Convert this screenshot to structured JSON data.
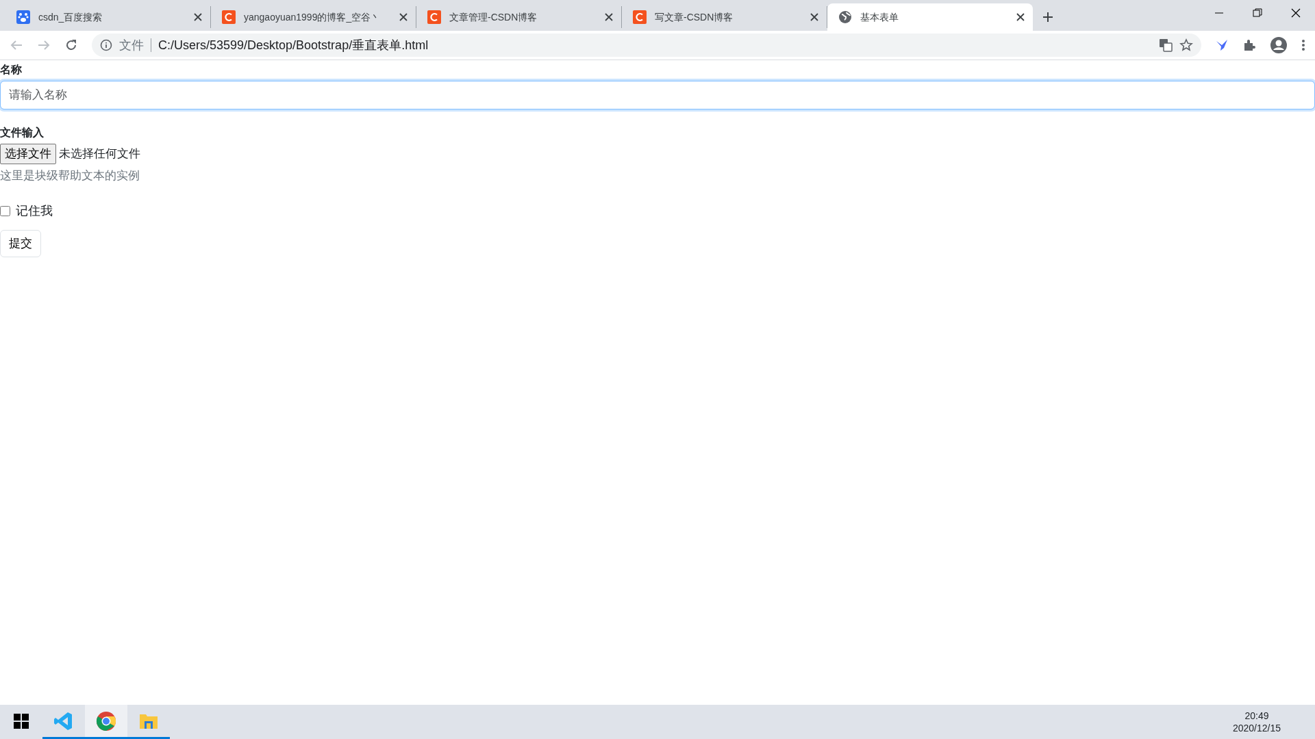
{
  "tabs": [
    {
      "title": "csdn_百度搜索",
      "kind": "paw",
      "selected": false
    },
    {
      "title": "yangaoyuan1999的博客_空谷丶",
      "kind": "csdn",
      "selected": false
    },
    {
      "title": "文章管理-CSDN博客",
      "kind": "csdn",
      "selected": false
    },
    {
      "title": "写文章-CSDN博客",
      "kind": "csdn",
      "selected": false
    },
    {
      "title": "基本表单",
      "kind": "globe",
      "selected": true
    }
  ],
  "address": {
    "label": "文件",
    "url": "C:/Users/53599/Desktop/Bootstrap/垂直表单.html"
  },
  "form": {
    "name_label": "名称",
    "name_placeholder": "请输入名称",
    "file_label": "文件输入",
    "file_button": "选择文件",
    "file_status": "未选择任何文件",
    "help_text": "这里是块级帮助文本的实例",
    "remember_label": "记住我",
    "remember_checked": false,
    "submit": "提交"
  },
  "taskbar": {
    "apps": [
      {
        "kind": "code",
        "running": true,
        "selected": false
      },
      {
        "kind": "chrome",
        "running": true,
        "selected": true
      },
      {
        "kind": "folder",
        "running": true,
        "selected": false
      }
    ],
    "time": "20:49",
    "date": "2020/12/15"
  }
}
